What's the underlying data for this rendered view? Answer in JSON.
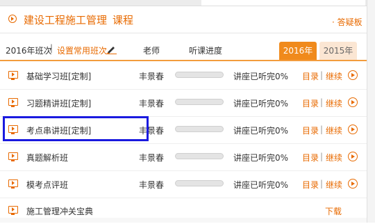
{
  "title": {
    "main": "建设工程施工管理",
    "course": "课程"
  },
  "tool_link": "· 答疑板",
  "header": {
    "year_label": "2016年班次",
    "separator": "|",
    "set_common": "设置常用班次",
    "teacher": "老师",
    "progress": "听课进度",
    "tabs": [
      "2016年",
      "2015年"
    ],
    "active_tab": "2016年"
  },
  "rows": [
    {
      "name": "基础学习班[定制]",
      "teacher": "丰景春",
      "progress": 0,
      "status": "讲座已听完0%",
      "catalog": "目录",
      "sep": "|",
      "continue": "继续"
    },
    {
      "name": "习题精讲班[定制]",
      "teacher": "丰景春",
      "progress": 0,
      "status": "讲座已听完0%",
      "catalog": "目录",
      "sep": "|",
      "continue": "继续"
    },
    {
      "name": "考点串讲班[定制]",
      "teacher": "丰景春",
      "progress": 0,
      "status": "讲座已听完0%",
      "catalog": "目录",
      "sep": "|",
      "continue": "继续"
    },
    {
      "name": "真题解析班",
      "teacher": "丰景春",
      "progress": 0,
      "status": "讲座已听完0%",
      "catalog": "目录",
      "sep": "|",
      "continue": "继续"
    },
    {
      "name": "模考点评班",
      "teacher": "丰景春",
      "progress": 0,
      "status": "讲座已听完0%",
      "catalog": "目录",
      "sep": "|",
      "continue": "继续"
    }
  ],
  "extra_row": {
    "name": "施工管理冲关宝典",
    "download": "下载"
  },
  "colors": {
    "accent": "#e86a00",
    "tab_active": "#f08a1c",
    "highlight_border": "#1a1adf"
  },
  "icons": {
    "title": "circle-play-icon",
    "row": "video-lesson-icon",
    "play": "circle-play-icon",
    "edit": "pencil-icon"
  }
}
